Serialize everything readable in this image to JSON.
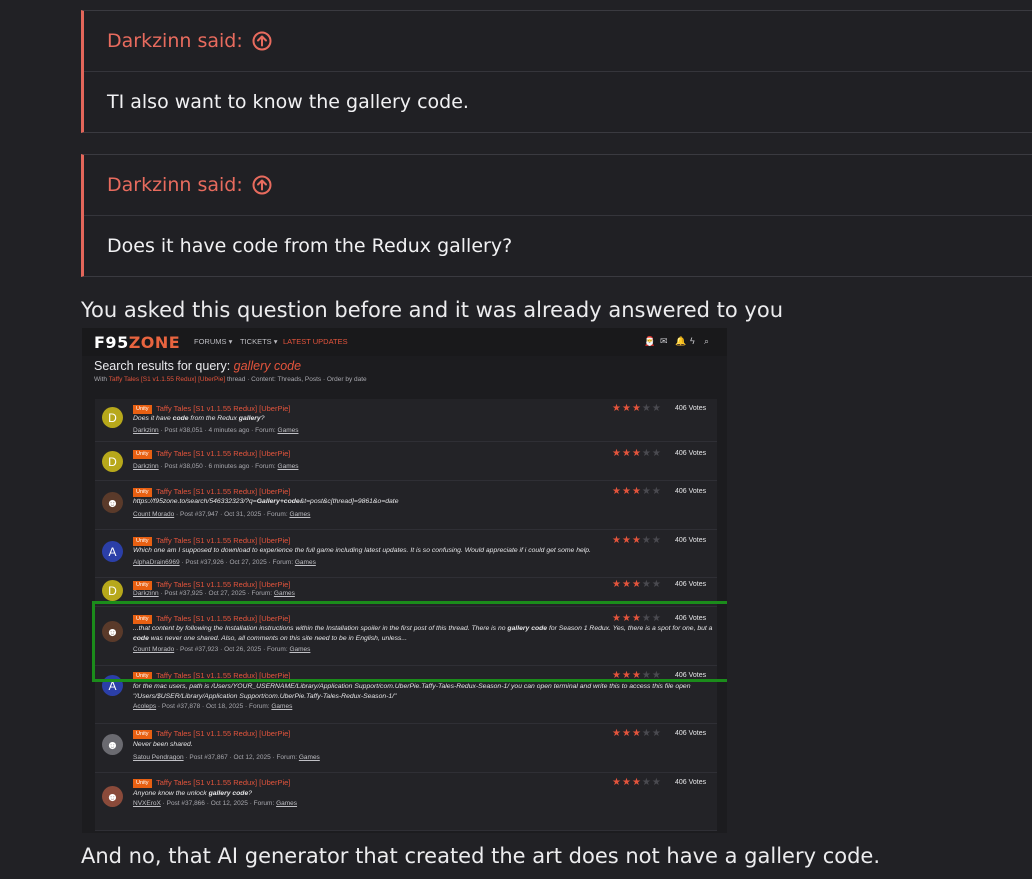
{
  "quotes": [
    {
      "author_line": "Darkzinn said:",
      "text": "TI also want to know the gallery code."
    },
    {
      "author_line": "Darkzinn said:",
      "text": "Does it have code from the Redux gallery?"
    }
  ],
  "reply_line_1": "You asked this question before and it was already answered to you",
  "reply_line_2": "And no, that AI generator that created the art does not have a gallery code.",
  "screenshot": {
    "logo_main": "F95",
    "logo_accent": "ZONE",
    "nav": [
      "FORUMS ▾",
      "TICKETS ▾",
      "LATEST UPDATES"
    ],
    "title_prefix": "Search results for query: ",
    "query": "gallery code",
    "sub_prefix": "With ",
    "sub_thread": "Taffy Tales [S1 v1.1.55 Redux] [UberPie]",
    "sub_suffix": " thread · Content: Threads, Posts · Order by date",
    "tag": "Unity",
    "thread_title": "Taffy Tales [S1 v1.1.55 Redux] [UberPie]",
    "results": [
      {
        "avatar": "D",
        "avatar_color": "#b7a81b",
        "snippet": "Does it have code from the Redux gallery?",
        "author": "Darkzinn",
        "meta": " · Post #38,051 · 4 minutes ago · Forum: ",
        "forum": "Games",
        "votes": "406 Votes"
      },
      {
        "avatar": "D",
        "avatar_color": "#b7a81b",
        "snippet": "",
        "author": "Darkzinn",
        "meta": " · Post #38,050 · 6 minutes ago · Forum: ",
        "forum": "Games",
        "votes": "406 Votes"
      },
      {
        "avatar": "",
        "avatar_color": "#5a3a2a",
        "snippet": "https://f95zone.to/search/546332323/?q=Gallery+code&t=post&c[thread]=9861&o=date",
        "author": "Count Morado",
        "meta": " · Post #37,947 · Oct 31, 2025 · Forum: ",
        "forum": "Games",
        "votes": "406 Votes"
      },
      {
        "avatar": "A",
        "avatar_color": "#2b3fa8",
        "snippet": "Which one am I supposed to download to experience the full game including latest updates. It is so confusing. Would appreciate if i could get some help.",
        "author": "AlphaDrain6969",
        "meta": " · Post #37,926 · Oct 27, 2025 · Forum: ",
        "forum": "Games",
        "votes": "406 Votes"
      },
      {
        "avatar": "D",
        "avatar_color": "#b7a81b",
        "snippet": "",
        "author": "Darkzinn",
        "meta": " · Post #37,925 · Oct 27, 2025 · Forum: ",
        "forum": "Games",
        "votes": "406 Votes"
      },
      {
        "avatar": "",
        "avatar_color": "#5a3a2a",
        "snippet": "...that content by following the Installation instructions within the Installation spoiler in the first post of this thread. There is no gallery code for Season 1 Redux. Yes, there is a spot for one, but a code was never one shared. Also, all comments on this site need to be in English, unless...",
        "author": "Count Morado",
        "meta": " · Post #37,923 · Oct 26, 2025 · Forum: ",
        "forum": "Games",
        "votes": "406 Votes"
      },
      {
        "avatar": "A",
        "avatar_color": "#2b3fa8",
        "snippet": "for the mac users, path is /Users/YOUR_USERNAME/Library/Application Support/com.UberPie.Taffy-Tales-Redux-Season-1/ you can open terminal and write this to access this file open \"/Users/$USER/Library/Application Support/com.UberPie.Taffy-Tales-Redux-Season-1/\"",
        "author": "Acoleps",
        "meta": " · Post #37,878 · Oct 18, 2025 · Forum: ",
        "forum": "Games",
        "votes": "406 Votes"
      },
      {
        "avatar": "",
        "avatar_color": "#6a6a70",
        "snippet": "Never been shared.",
        "author": "Satou Pendragon",
        "meta": " · Post #37,867 · Oct 12, 2025 · Forum: ",
        "forum": "Games",
        "votes": "406 Votes"
      },
      {
        "avatar": "",
        "avatar_color": "#8a4a3a",
        "snippet": "Anyone know the unlock gallery code?",
        "author": "NVXEroX",
        "meta": " · Post #37,866 · Oct 12, 2025 · Forum: ",
        "forum": "Games",
        "votes": "406 Votes"
      }
    ],
    "rating": 3,
    "rating_max": 5,
    "accent_color": "#e3543c",
    "highlight_color": "#1b8c1b"
  }
}
